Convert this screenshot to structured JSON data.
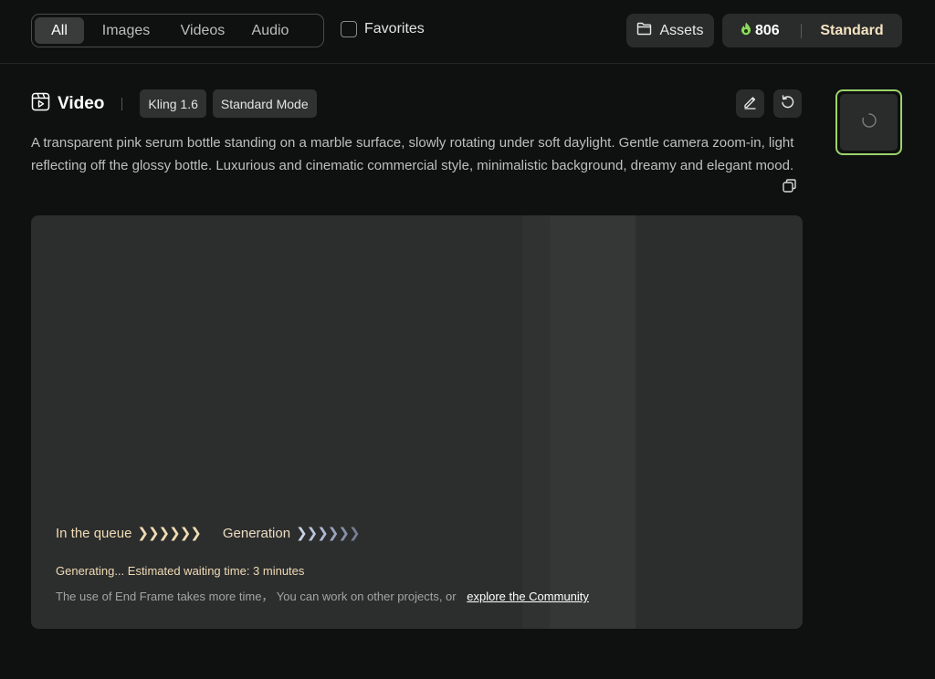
{
  "tabs": [
    "All",
    "Images",
    "Videos",
    "Audio"
  ],
  "favorites_label": "Favorites",
  "assets_label": "Assets",
  "credits": {
    "count": "806",
    "plan": "Standard"
  },
  "video": {
    "title": "Video",
    "model": "Kling 1.6",
    "mode": "Standard Mode",
    "prompt": "A transparent pink serum bottle standing on a marble surface, slowly rotating under soft daylight. Gentle camera zoom-in, light reflecting off the glossy bottle. Luxurious and cinematic commercial style, minimalistic background, dreamy and elegant mood."
  },
  "progress": {
    "queue_label": "In the queue",
    "queue_arrows": "❯❯❯❯❯❯",
    "generation_label": "Generation",
    "generation_arrows": "❯❯❯❯❯❯",
    "status": "Generating... Estimated waiting time: 3 minutes",
    "note": "The use of End Frame takes more time，  You can work on other projects, or",
    "link": "explore the Community"
  },
  "colors": {
    "accent_gold": "#f0dcb5",
    "flame_green": "#8bdc5b",
    "thumb_border": "#9cd36a",
    "arrow_blue": "#aeb8d2"
  }
}
